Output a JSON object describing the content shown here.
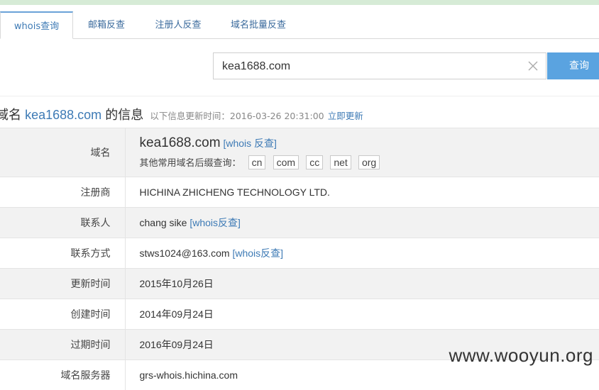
{
  "tabs": [
    "whois查询",
    "邮箱反查",
    "注册人反查",
    "域名批量反查"
  ],
  "search": {
    "value": "kea1688.com",
    "button": "查询"
  },
  "info_header": {
    "prefix": "域名",
    "domain": "kea1688.com",
    "suffix": "的信息",
    "updated": "以下信息更新时间：2016-03-26 20:31:00",
    "refresh": "立即更新"
  },
  "rows": {
    "domain": {
      "label": "域名",
      "value": "kea1688.com",
      "link": "[whois 反查]",
      "suffix_label": "其他常用域名后缀查询：",
      "suffixes": [
        "cn",
        "com",
        "cc",
        "net",
        "org"
      ]
    },
    "registrar": {
      "label": "注册商",
      "value": "HICHINA ZHICHENG TECHNOLOGY LTD."
    },
    "contact": {
      "label": "联系人",
      "value": "chang sike",
      "link": "[whois反查]"
    },
    "contact_method": {
      "label": "联系方式",
      "value": "stws1024@163.com",
      "link": "[whois反查]"
    },
    "updated": {
      "label": "更新时间",
      "value": "2015年10月26日"
    },
    "created": {
      "label": "创建时间",
      "value": "2014年09月24日"
    },
    "expires": {
      "label": "过期时间",
      "value": "2016年09月24日"
    },
    "nameserver": {
      "label": "域名服务器",
      "value": "grs-whois.hichina.com"
    }
  },
  "watermark": "www.wooyun.org"
}
